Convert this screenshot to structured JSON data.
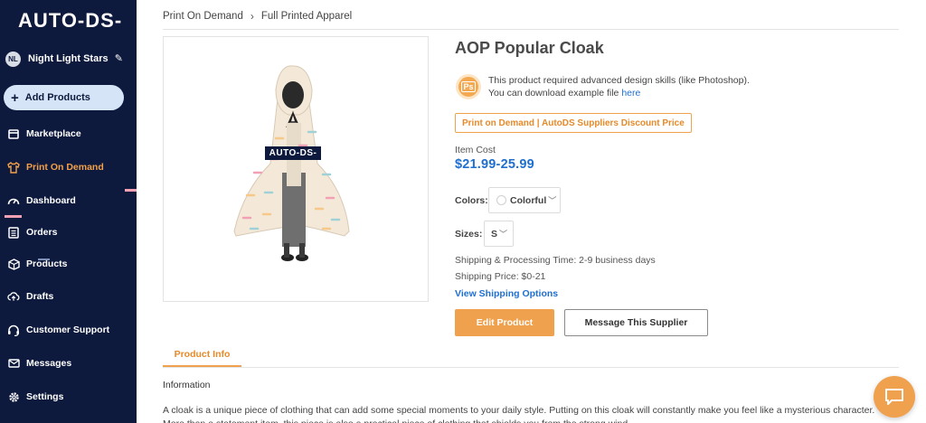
{
  "sidebar": {
    "logo": "AUTO-DS-",
    "user": {
      "initials": "NL",
      "name": "Night Light Stars"
    },
    "add_products": "Add Products",
    "items": [
      {
        "label": "Marketplace",
        "icon": "store-icon"
      },
      {
        "label": "Print On Demand",
        "icon": "shirt-icon",
        "active": true
      },
      {
        "label": "Dashboard",
        "icon": "gauge-icon"
      },
      {
        "label": "Orders",
        "icon": "list-icon"
      },
      {
        "label": "Products",
        "icon": "box-icon"
      },
      {
        "label": "Drafts",
        "icon": "cloud-upload-icon"
      },
      {
        "label": "Customer Support",
        "icon": "headset-icon"
      },
      {
        "label": "Messages",
        "icon": "envelope-icon"
      },
      {
        "label": "Settings",
        "icon": "gear-icon"
      }
    ]
  },
  "breadcrumb": {
    "parent": "Print On Demand",
    "current": "Full Printed Apparel"
  },
  "product": {
    "title": "AOP Popular Cloak",
    "image_watermark": "AUTO-DS-",
    "design_note_line1": "This product required advanced design skills (like Photoshop).",
    "design_note_line2": "You can download example file",
    "design_note_link": "here",
    "tag": "Print on Demand | AutoDS Suppliers Discount Price",
    "item_cost_label": "Item Cost",
    "item_cost": "$21.99-25.99",
    "colors_label": "Colors:",
    "color_value": "Colorful",
    "sizes_label": "Sizes:",
    "size_value": "S",
    "shipping_time": "Shipping & Processing Time: 2-9 business days",
    "shipping_price": "Shipping Price: $0-21",
    "view_shipping": "View Shipping Options",
    "edit_button": "Edit Product",
    "message_button": "Message This Supplier"
  },
  "tabs": {
    "product_info": "Product Info"
  },
  "info": {
    "heading": "Information",
    "description": "A cloak is a unique piece of clothing that can add some special moments to your daily style. Putting on this cloak will constantly make you feel like a mysterious character. More than a statement item, this piece is also a practical piece of clothing that shields you from the strong wind."
  },
  "colors": {
    "accent": "#f0a14e",
    "sidebar_bg": "#0e1a3d",
    "link": "#1f6fd0"
  }
}
